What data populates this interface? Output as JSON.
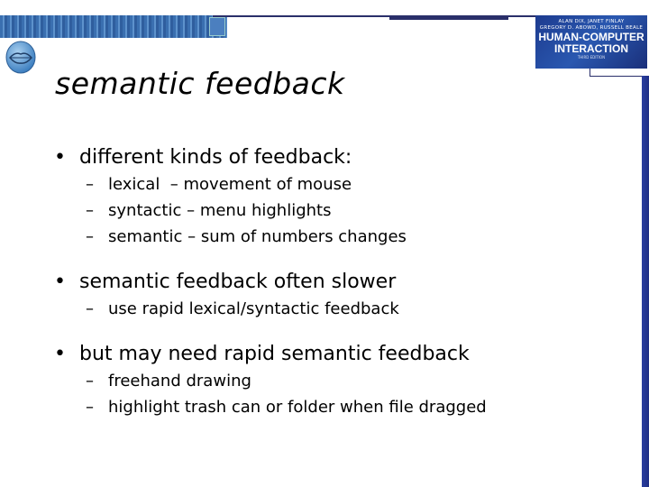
{
  "title": "semantic feedback",
  "book_cover": {
    "authors_line1": "ALAN DIX, JANET FINLAY",
    "authors_line2": "GREGORY D. ABOWD, RUSSELL BEALE",
    "title_line1": "HUMAN-COMPUTER",
    "title_line2": "INTERACTION",
    "edition": "THIRD EDITION"
  },
  "bullets": [
    {
      "text": "different kinds of feedback:",
      "sub": [
        "lexical  – movement of mouse",
        "syntactic – menu highlights",
        "semantic – sum of numbers changes"
      ]
    },
    {
      "text": "semantic feedback often slower",
      "sub": [
        "use rapid lexical/syntactic feedback"
      ]
    },
    {
      "text": "but may need rapid semantic feedback",
      "sub": [
        "freehand drawing",
        "highlight trash can or folder when file dragged"
      ]
    }
  ],
  "dash": "–"
}
